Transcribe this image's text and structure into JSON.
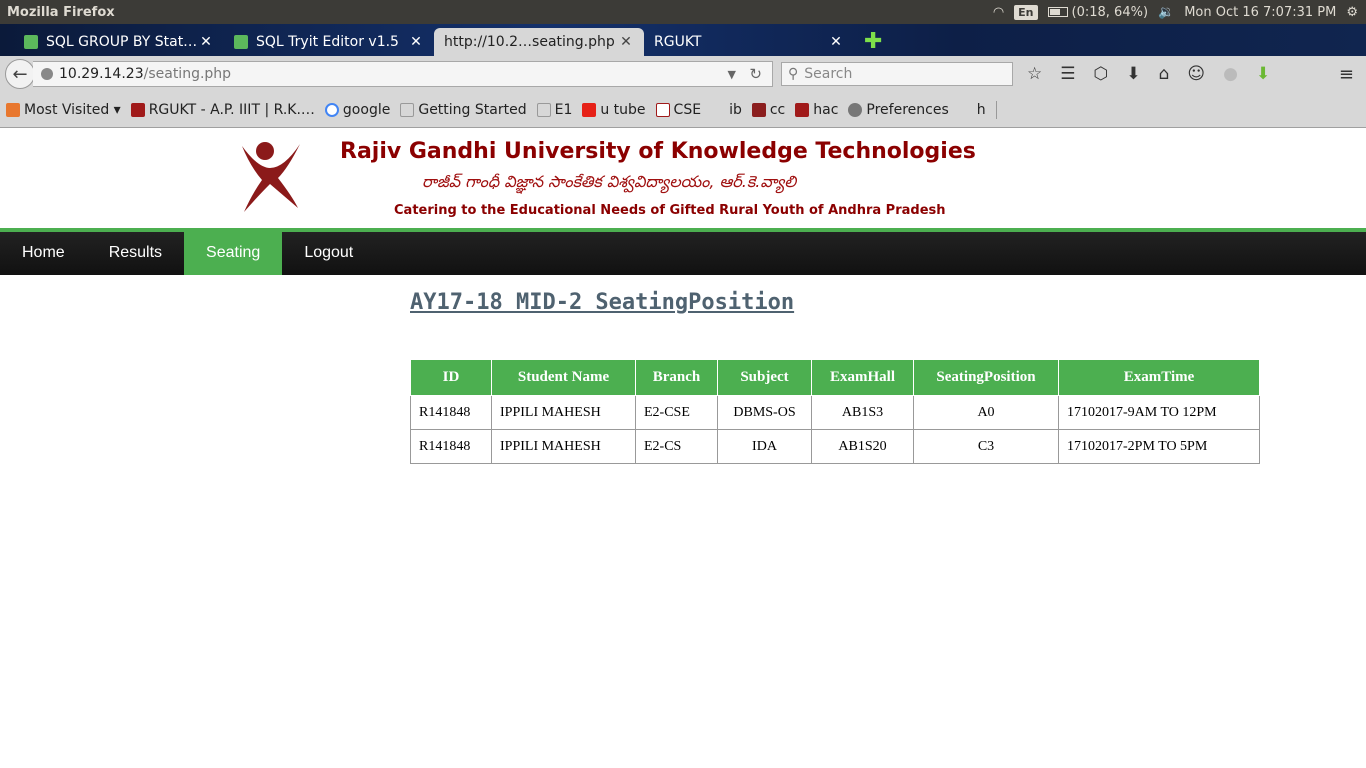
{
  "os": {
    "app_title": "Mozilla Firefox",
    "lang": "En",
    "battery": "(0:18, 64%)",
    "datetime": "Mon Oct 16  7:07:31 PM"
  },
  "tabs": [
    {
      "label": "SQL GROUP BY Stat…"
    },
    {
      "label": "SQL Tryit Editor v1.5"
    },
    {
      "label": "http://10.2…seating.php"
    },
    {
      "label": "RGUKT"
    }
  ],
  "navbar": {
    "url_host": "10.29.14.23",
    "url_path": "/seating.php",
    "search_placeholder": "Search"
  },
  "bookmarks": [
    {
      "label": "Most Visited ▾"
    },
    {
      "label": "RGUKT - A.P. IIIT | R.K.…"
    },
    {
      "label": "google"
    },
    {
      "label": "Getting Started"
    },
    {
      "label": "E1"
    },
    {
      "label": "u tube"
    },
    {
      "label": "CSE"
    },
    {
      "label": "ib"
    },
    {
      "label": "cc"
    },
    {
      "label": "hac"
    },
    {
      "label": "Preferences"
    },
    {
      "label": "h"
    }
  ],
  "header": {
    "university": "Rajiv Gandhi University of Knowledge Technologies",
    "telugu": "రాజీవ్ గాంధీ విజ్ఞాన సాంకేతిక విశ్వవిద్యాలయం, ఆర్.కె.వ్యాలి",
    "tagline": "Catering to the Educational Needs of Gifted Rural Youth of Andhra Pradesh"
  },
  "site_nav": [
    "Home",
    "Results",
    "Seating",
    "Logout"
  ],
  "main": {
    "heading": "AY17-18 MID-2 SeatingPosition",
    "columns": [
      "ID",
      "Student Name",
      "Branch",
      "Subject",
      "ExamHall",
      "SeatingPosition",
      "ExamTime"
    ],
    "rows": [
      [
        "R141848",
        "IPPILI MAHESH",
        "E2-CSE",
        "DBMS-OS",
        "AB1S3",
        "A0",
        "17102017-9AM TO 12PM"
      ],
      [
        "R141848",
        "IPPILI MAHESH",
        "E2-CS",
        "IDA",
        "AB1S20",
        "C3",
        "17102017-2PM TO 5PM"
      ]
    ]
  },
  "colors": {
    "accent_green": "#4caf50",
    "brand_maroon": "#8b0000"
  }
}
